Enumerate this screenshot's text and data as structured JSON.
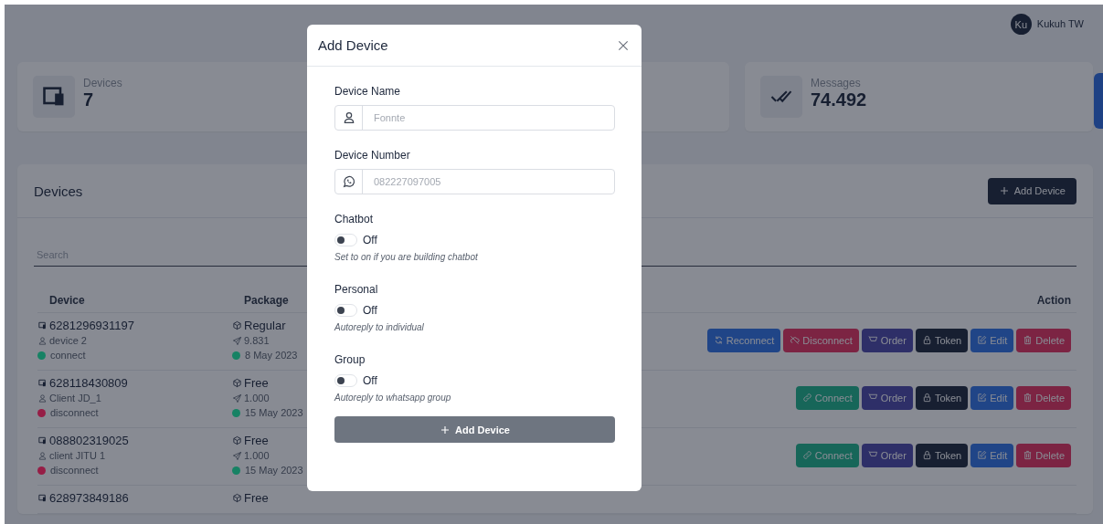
{
  "user": {
    "initials": "Ku",
    "name": "Kukuh TW"
  },
  "stats": [
    {
      "kind": "devices",
      "label": "Devices",
      "value": "7"
    },
    {
      "kind": "hidden"
    },
    {
      "kind": "messages",
      "label": "Messages",
      "value": "74.492"
    }
  ],
  "devices_panel": {
    "title": "Devices",
    "add_button": "Add Device",
    "search": {
      "placeholder": "Search"
    },
    "table": {
      "columns": [
        "Device",
        "Package",
        "Action"
      ],
      "rows": [
        {
          "number": "6281296931197",
          "name": "device 2",
          "status": {
            "text": "connect",
            "color": "#178264"
          },
          "package": "Regular",
          "quota": "9.831",
          "expiry": {
            "text": "8 May 2023",
            "color": "#178264"
          },
          "actions": [
            {
              "kind": "reconnect",
              "label": "Reconnect"
            },
            {
              "kind": "disconnect",
              "label": "Disconnect"
            },
            {
              "kind": "order",
              "label": "Order"
            },
            {
              "kind": "token",
              "label": "Token"
            },
            {
              "kind": "edit",
              "label": "Edit"
            },
            {
              "kind": "delete",
              "label": "Delete"
            }
          ]
        },
        {
          "number": "628118430809",
          "name": "Client JD_1",
          "status": {
            "text": "disconnect",
            "color": "#961e46"
          },
          "package": "Free",
          "quota": "1.000",
          "expiry": {
            "text": "15 May 2023",
            "color": "#178264"
          },
          "actions": [
            {
              "kind": "connect",
              "label": "Connect"
            },
            {
              "kind": "order",
              "label": "Order"
            },
            {
              "kind": "token",
              "label": "Token"
            },
            {
              "kind": "edit",
              "label": "Edit"
            },
            {
              "kind": "delete",
              "label": "Delete"
            }
          ]
        },
        {
          "number": "088802319025",
          "name": "client JITU 1",
          "status": {
            "text": "disconnect",
            "color": "#961e46"
          },
          "package": "Free",
          "quota": "1.000",
          "expiry": {
            "text": "15 May 2023",
            "color": "#178264"
          },
          "actions": [
            {
              "kind": "connect",
              "label": "Connect"
            },
            {
              "kind": "order",
              "label": "Order"
            },
            {
              "kind": "token",
              "label": "Token"
            },
            {
              "kind": "edit",
              "label": "Edit"
            },
            {
              "kind": "delete",
              "label": "Delete"
            }
          ]
        },
        {
          "number": "628973849186",
          "package": "Free"
        }
      ]
    }
  },
  "modal": {
    "title": "Add Device",
    "fields": [
      {
        "kind": "name",
        "label": "Device Name",
        "placeholder": "Fonnte"
      },
      {
        "kind": "phone",
        "label": "Device Number",
        "placeholder": "082227097005"
      },
      {
        "kind": "toggle",
        "label": "Chatbot",
        "checked": false,
        "state": "Off",
        "hint": "Set to on if you are building chatbot"
      },
      {
        "kind": "toggle",
        "label": "Personal",
        "checked": false,
        "state": "Off",
        "hint": "Autoreply to individual"
      },
      {
        "kind": "toggle",
        "label": "Group",
        "checked": false,
        "state": "Off",
        "hint": "Autoreply to whatsapp group"
      }
    ],
    "submit": "Add Device"
  }
}
